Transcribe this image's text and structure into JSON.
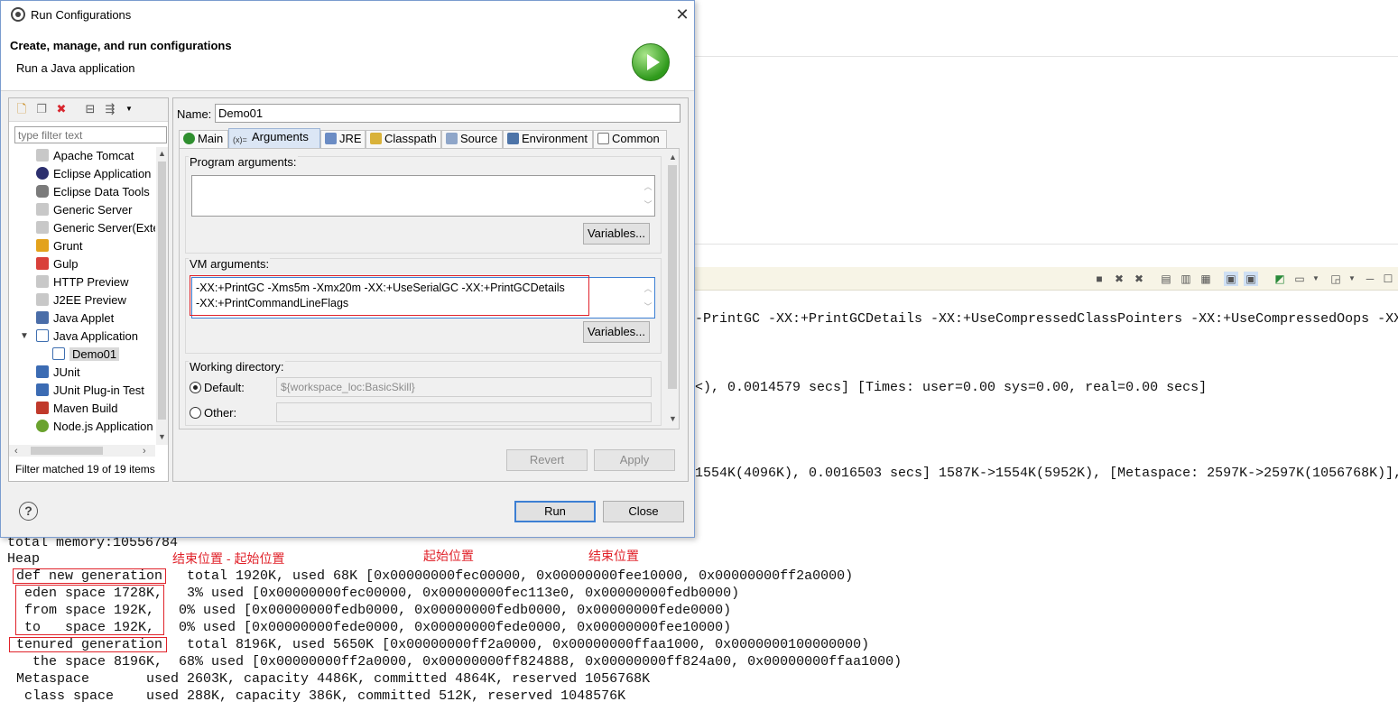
{
  "dialog": {
    "title": "Run Configurations",
    "header_title": "Create, manage, and run configurations",
    "header_subtitle": "Run a Java application"
  },
  "left_panel": {
    "filter_placeholder": "type filter text",
    "tree": [
      {
        "label": "Apache Tomcat",
        "icon": "server-icon",
        "color": "#8a8a8a"
      },
      {
        "label": "Eclipse Application",
        "icon": "eclipse-icon",
        "color": "#2c2f6e"
      },
      {
        "label": "Eclipse Data Tools",
        "icon": "database-icon",
        "color": "#7b7b7b"
      },
      {
        "label": "Generic Server",
        "icon": "server-icon",
        "color": "#8a8a8a"
      },
      {
        "label": "Generic Server(Exte",
        "icon": "server-icon",
        "color": "#8a8a8a"
      },
      {
        "label": "Grunt",
        "icon": "grunt-icon",
        "color": "#e3a21c"
      },
      {
        "label": "Gulp",
        "icon": "gulp-icon",
        "color": "#d9403a"
      },
      {
        "label": "HTTP Preview",
        "icon": "server-icon",
        "color": "#8a8a8a"
      },
      {
        "label": "J2EE Preview",
        "icon": "server-icon",
        "color": "#8a8a8a"
      },
      {
        "label": "Java Applet",
        "icon": "applet-icon",
        "color": "#4a6da8"
      },
      {
        "label": "Java Application",
        "icon": "java-app-icon",
        "color": "#3f6fb0"
      },
      {
        "label": "Demo01",
        "icon": "java-app-icon",
        "color": "#3f6fb0"
      },
      {
        "label": "JUnit",
        "icon": "junit-icon",
        "color": "#3b6bb3"
      },
      {
        "label": "JUnit Plug-in Test",
        "icon": "junit-icon",
        "color": "#3b6bb3"
      },
      {
        "label": "Maven Build",
        "icon": "maven-icon",
        "color": "#c0392b"
      },
      {
        "label": "Node.js Application",
        "icon": "nodejs-icon",
        "color": "#6aa22e"
      }
    ],
    "status": "Filter matched 19 of 19 items"
  },
  "right_panel": {
    "name_label": "Name:",
    "name_value": "Demo01",
    "tabs": [
      {
        "label": "Main",
        "icon": "main-tab-icon"
      },
      {
        "label": "Arguments",
        "icon": "arguments-tab-icon"
      },
      {
        "label": "JRE",
        "icon": "jre-tab-icon"
      },
      {
        "label": "Classpath",
        "icon": "classpath-tab-icon"
      },
      {
        "label": "Source",
        "icon": "source-tab-icon"
      },
      {
        "label": "Environment",
        "icon": "environment-tab-icon"
      },
      {
        "label": "Common",
        "icon": "common-tab-icon"
      }
    ],
    "program_arguments_label": "Program arguments:",
    "program_arguments_value": "",
    "variables_label": "Variables...",
    "vm_arguments_label": "VM arguments:",
    "vm_arguments_lines": [
      "-XX:+PrintGC -Xms5m -Xmx20m -XX:+UseSerialGC -XX:+PrintGCDetails",
      "-XX:+PrintCommandLineFlags"
    ],
    "working_directory_label": "Working directory:",
    "default_label": "Default:",
    "default_value": "${workspace_loc:BasicSkill}",
    "other_label": "Other:",
    "other_value": "",
    "revert_label": "Revert",
    "apply_label": "Apply"
  },
  "footer": {
    "run_label": "Run",
    "close_label": "Close"
  },
  "console": {
    "lines_right": [
      "-PrintGC -XX:+PrintGCDetails -XX:+UseCompressedClassPointers -XX:+UseCompressedOops -XX",
      "<), 0.0014579 secs] [Times: user=0.00 sys=0.00, real=0.00 secs]",
      "1554K(4096K), 0.0016503 secs] 1587K->1554K(5952K), [Metaspace: 2597K->2597K(1056768K)],"
    ],
    "lines_bottom": [
      "total memory:10556784",
      "Heap",
      "  def new generation   total 1920K, used 68K [0x00000000fec00000, 0x00000000fee10000, 0x00000000ff2a0000)",
      "   eden space 1728K,   3% used [0x00000000fec00000, 0x00000000fec113e0, 0x00000000fedb0000)",
      "   from space 192K,   0% used [0x00000000fedb0000, 0x00000000fedb0000, 0x00000000fede0000)",
      "   to   space 192K,   0% used [0x00000000fede0000, 0x00000000fede0000, 0x00000000fee10000)",
      "  tenured generation   total 8196K, used 5650K [0x00000000ff2a0000, 0x00000000ffaa1000, 0x0000000100000000)",
      "    the space 8196K,  68% used [0x00000000ff2a0000, 0x00000000ff824888, 0x00000000ff824a00, 0x00000000ffaa1000)",
      "  Metaspace       used 2603K, capacity 4486K, committed 4864K, reserved 1056768K",
      "   class space    used 288K, capacity 386K, committed 512K, reserved 1048576K"
    ],
    "annotations": {
      "end_minus_start": "结束位置 - 起始位置",
      "start": "起始位置",
      "end": "结束位置"
    },
    "highlight_color": "#e0222a"
  }
}
